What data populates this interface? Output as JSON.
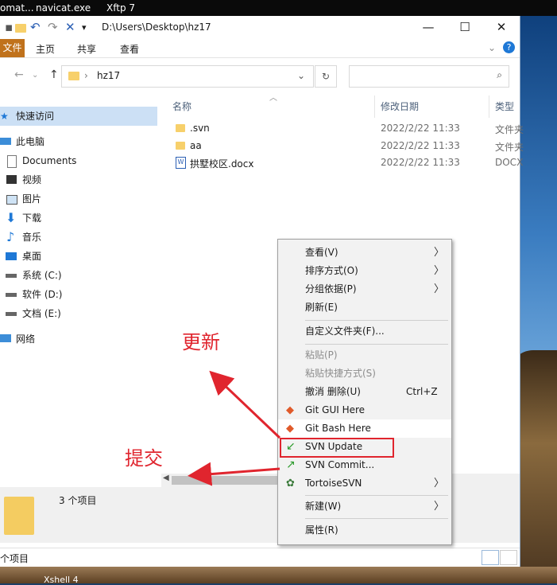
{
  "taskbar_top": {
    "items": [
      "omat...",
      "navicat.exe",
      "Xftp 7"
    ]
  },
  "taskbar_bottom": {
    "label": "Xshell 4"
  },
  "window": {
    "title_path": "D:\\Users\\Desktop\\hz17",
    "controls": {
      "minimize": "—",
      "maximize": "☐",
      "close": "✕"
    }
  },
  "ribbon": {
    "file": "文件",
    "tabs": [
      "主页",
      "共享",
      "查看"
    ]
  },
  "address": {
    "folder": "hz17",
    "search_placeholder": ""
  },
  "sidebar": {
    "items": [
      {
        "label": "快速访问",
        "icon": "star-icon"
      },
      {
        "label": "此电脑",
        "icon": "computer-icon"
      },
      {
        "label": "Documents",
        "icon": "documents-icon"
      },
      {
        "label": "视频",
        "icon": "video-icon"
      },
      {
        "label": "图片",
        "icon": "picture-icon"
      },
      {
        "label": "下载",
        "icon": "download-icon"
      },
      {
        "label": "音乐",
        "icon": "music-icon"
      },
      {
        "label": "桌面",
        "icon": "desktop-icon"
      },
      {
        "label": "系统 (C:)",
        "icon": "drive-icon"
      },
      {
        "label": "软件 (D:)",
        "icon": "drive-icon"
      },
      {
        "label": "文档 (E:)",
        "icon": "drive-icon"
      },
      {
        "label": "网络",
        "icon": "network-icon"
      }
    ]
  },
  "filelist": {
    "columns": [
      "名称",
      "修改日期",
      "类型"
    ],
    "rows": [
      {
        "name": ".svn",
        "date": "2022/2/22 11:33",
        "type": "文件夹",
        "icon": "folder-icon"
      },
      {
        "name": "aa",
        "date": "2022/2/22 11:33",
        "type": "文件夹",
        "icon": "folder-icon"
      },
      {
        "name": "拱墅校区.docx",
        "date": "2022/2/22 11:33",
        "type": "DOCX",
        "icon": "word-doc-icon"
      }
    ]
  },
  "preview": {
    "count": "3 个项目"
  },
  "status": {
    "count": "个项目"
  },
  "context_menu": {
    "items": [
      {
        "label": "查看(V)",
        "submenu": true
      },
      {
        "label": "排序方式(O)",
        "submenu": true
      },
      {
        "label": "分组依据(P)",
        "submenu": true
      },
      {
        "label": "刷新(E)"
      },
      {
        "label": "自定义文件夹(F)..."
      },
      {
        "label": "粘贴(P)",
        "disabled": true
      },
      {
        "label": "粘贴快捷方式(S)",
        "disabled": true
      },
      {
        "label": "撤消 删除(U)",
        "shortcut": "Ctrl+Z"
      },
      {
        "label": "Git GUI Here",
        "icon": "git-icon"
      },
      {
        "label": "Git Bash Here",
        "icon": "git-icon"
      },
      {
        "label": "SVN Update",
        "icon": "svn-update-icon"
      },
      {
        "label": "SVN Commit...",
        "icon": "svn-commit-icon"
      },
      {
        "label": "TortoiseSVN",
        "icon": "tortoise-icon",
        "submenu": true
      },
      {
        "label": "新建(W)",
        "submenu": true
      },
      {
        "label": "属性(R)"
      }
    ]
  },
  "annotations": {
    "update": "更新",
    "commit": "提交"
  },
  "colors": {
    "accent": "#c0721c",
    "annotation": "#e0252e",
    "selection": "#cce0f5"
  }
}
